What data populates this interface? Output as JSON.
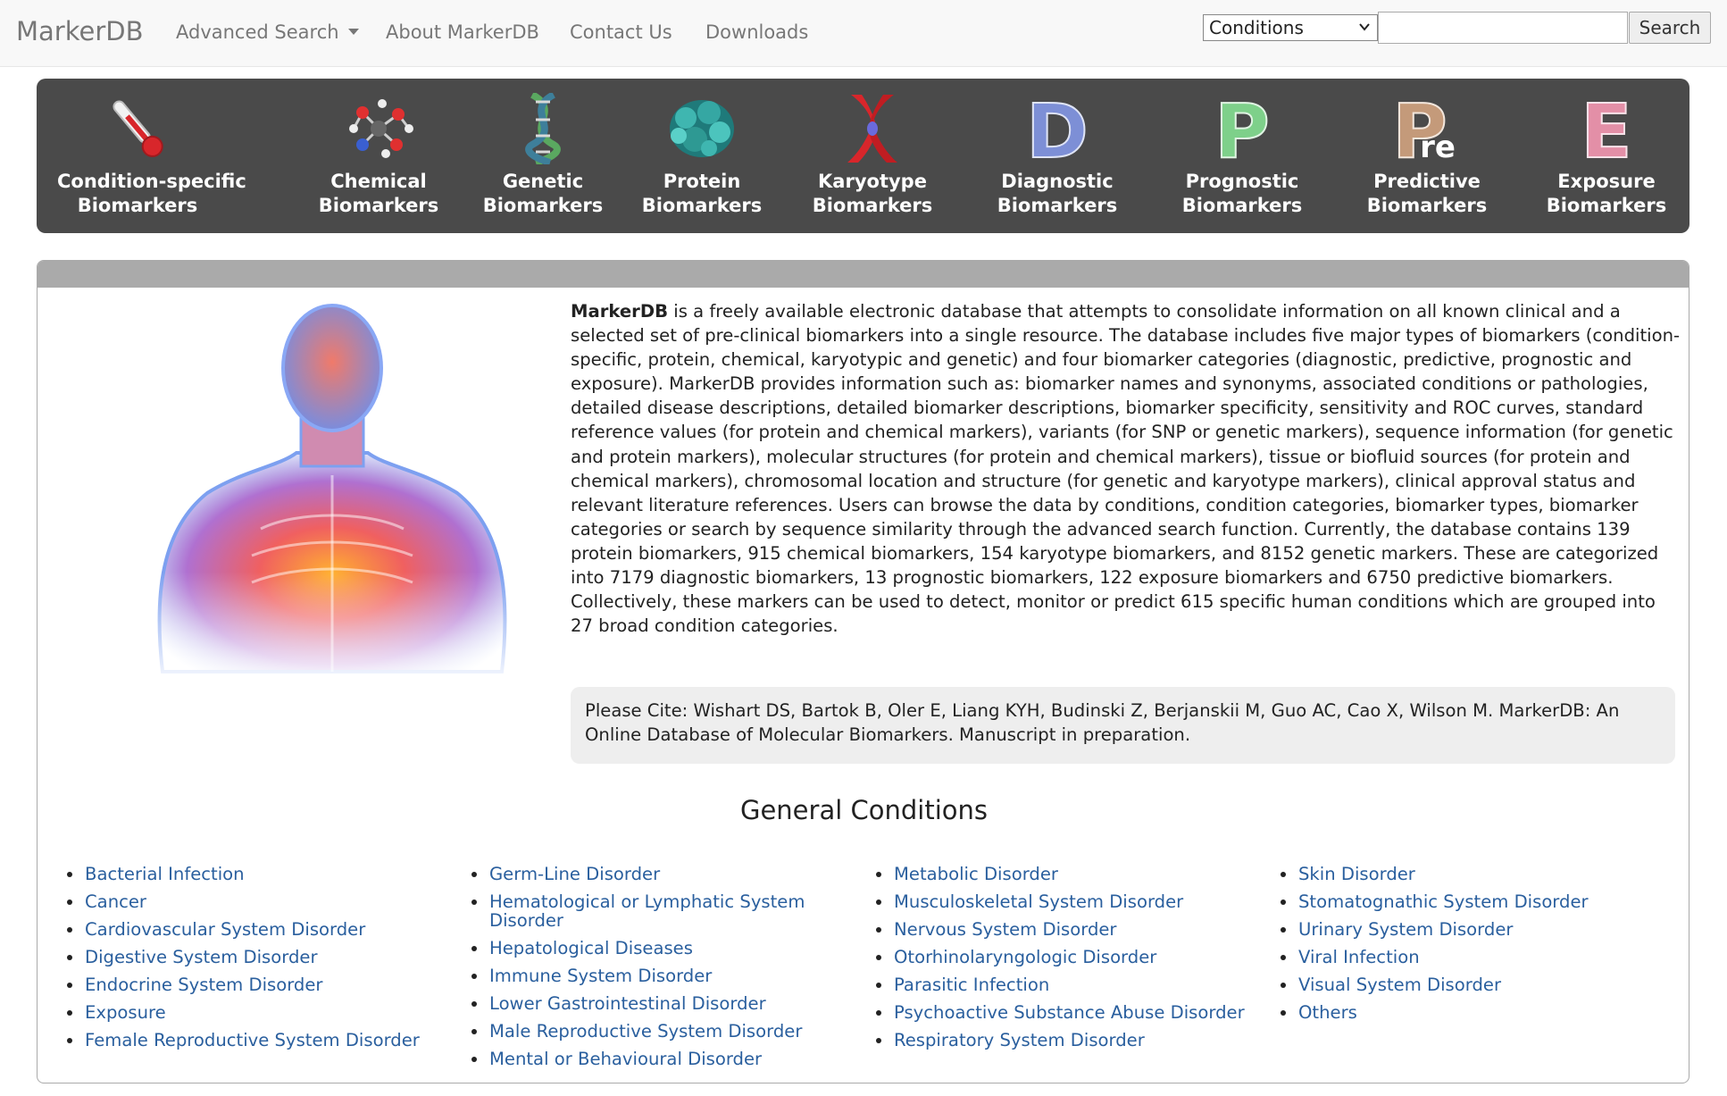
{
  "navbar": {
    "brand": "MarkerDB",
    "items": [
      "Advanced Search",
      "About MarkerDB",
      "Contact Us",
      "Downloads"
    ],
    "search_select": "Conditions",
    "search_value": "",
    "search_button": "Search"
  },
  "banner": {
    "tiles": [
      {
        "line1": "Condition-specific",
        "line2": "Biomarkers",
        "icon": "thermometer-icon"
      },
      {
        "line1": "Chemical",
        "line2": "Biomarkers",
        "icon": "molecule-icon"
      },
      {
        "line1": "Genetic",
        "line2": "Biomarkers",
        "icon": "dna-icon"
      },
      {
        "line1": "Protein",
        "line2": "Biomarkers",
        "icon": "protein-icon"
      },
      {
        "line1": "Karyotype",
        "line2": "Biomarkers",
        "icon": "chromosome-icon"
      },
      {
        "line1": "Diagnostic",
        "line2": "Biomarkers",
        "icon": "letter-d-icon"
      },
      {
        "line1": "Prognostic",
        "line2": "Biomarkers",
        "icon": "letter-p-icon"
      },
      {
        "line1": "Predictive",
        "line2": "Biomarkers",
        "icon": "letter-pre-icon"
      },
      {
        "line1": "Exposure",
        "line2": "Biomarkers",
        "icon": "letter-e-icon"
      }
    ],
    "letters": {
      "d": "D",
      "p": "P",
      "pre_p": "P",
      "pre_re": "re",
      "e": "E"
    },
    "colors": {
      "d": "#7d8fd6",
      "p": "#7ed08a",
      "pre": "#c49a7a",
      "e": "#e38fa7"
    }
  },
  "main": {
    "intro_bold": "MarkerDB",
    "intro_text": " is a freely available electronic database that attempts to consolidate information on all known clinical and a selected set of pre-clinical biomarkers into a single resource. The database includes five major types of biomarkers (condition-specific, protein, chemical, karyotypic and genetic) and four biomarker categories (diagnostic, predictive, prognostic and exposure). MarkerDB provides information such as: biomarker names and synonyms, associated conditions or pathologies, detailed disease descriptions, detailed biomarker descriptions, biomarker specificity, sensitivity and ROC curves, standard reference values (for protein and chemical markers), variants (for SNP or genetic markers), sequence information (for genetic and protein markers), molecular structures (for protein and chemical markers), tissue or biofluid sources (for protein and chemical markers), chromosomal location and structure (for genetic and karyotype markers), clinical approval status and relevant literature references. Users can browse the data by conditions, condition categories, biomarker types, biomarker categories or search by sequence similarity through the advanced search function. Currently, the database contains 139 protein biomarkers, 915 chemical biomarkers, 154 karyotype biomarkers, and 8152 genetic markers. These are categorized into 7179 diagnostic biomarkers, 13 prognostic biomarkers, 122 exposure biomarkers and 6750 predictive biomarkers. Collectively, these markers can be used to detect, monitor or predict 615 specific human conditions which are grouped into 27 broad condition categories.",
    "citation": "Please Cite: Wishart DS, Bartok B, Oler E, Liang KYH, Budinski Z, Berjanskii M, Guo AC, Cao X, Wilson M. MarkerDB: An Online Database of Molecular Biomarkers. Manuscript in preparation.",
    "section_title": "General Conditions",
    "conditions": [
      [
        "Bacterial Infection",
        "Cancer",
        "Cardiovascular System Disorder",
        "Digestive System Disorder",
        "Endocrine System Disorder",
        "Exposure",
        "Female Reproductive System Disorder"
      ],
      [
        "Germ-Line Disorder",
        "Hematological or Lymphatic System Disorder",
        "Hepatological Diseases",
        "Immune System Disorder",
        "Lower Gastrointestinal Disorder",
        "Male Reproductive System Disorder",
        "Mental or Behavioural Disorder"
      ],
      [
        "Metabolic Disorder",
        "Musculoskeletal System Disorder",
        "Nervous System Disorder",
        "Otorhinolaryngologic Disorder",
        "Parasitic Infection",
        "Psychoactive Substance Abuse Disorder",
        "Respiratory System Disorder"
      ],
      [
        "Skin Disorder",
        "Stomatognathic System Disorder",
        "Urinary System Disorder",
        "Viral Infection",
        "Visual System Disorder",
        "Others"
      ]
    ]
  },
  "colors": {
    "link": "#2a5f9e",
    "banner_bg": "#4a4a4a",
    "panel_header": "#aaaaaa",
    "cite_bg": "#eeeeee"
  }
}
